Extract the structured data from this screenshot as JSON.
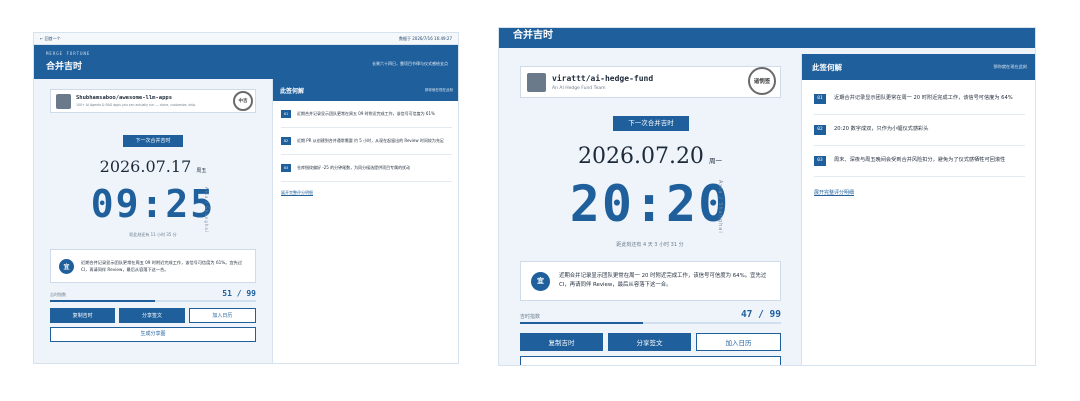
{
  "left_panel": {
    "nav": {
      "back": "← 回首一个",
      "published": "数据于 2026/7/16 16:49:27"
    },
    "header": {
      "kicker": "MERGE FORTUNE",
      "title": "合并吉时",
      "tagline": "长果六十四日，靠项目节律与仪式感给支点"
    },
    "repo": {
      "name": "Shubhamsaboo/awesome-llm-apps",
      "desc": "100+ AI Agents & RAG apps you can actually run — clone, customize, ship.",
      "seal": "中吉"
    },
    "next_button": "下一次合并吉时",
    "date": "2026.07.17",
    "weekday": "周五",
    "time": "09:25",
    "timezone": "Asia / Shanghai",
    "remaining": "距此刻还有 11 小时 35 分",
    "advice_badge": "宜",
    "advice": "近期合并记录显示团队更常在周五 09 时附近完成工作，该信号可信度为 61%。宜先过 CI，再请同伴 Review，最后从容落下这一合。",
    "index_label": "吉时指数",
    "index_value": "51 / 99",
    "index_fraction": 0.51,
    "buttons": {
      "copy": "复制吉时",
      "share": "分享签文",
      "calendar": "加入日历",
      "poster": "生成分享图"
    },
    "sign": {
      "title": "此签何解",
      "subtitle": "那你就在现在此刻",
      "items": [
        {
          "num": "01",
          "text": "近期合并记录显示团队更常在周五 09 时附近完成工作，该信号可信度为 61%"
        },
        {
          "num": "02",
          "text": "近期 PR 从创建到合并通常需要 约 5 小时，从现在起留出的 Review 时间较为充足"
        },
        {
          "num": "03",
          "text": "仓库指纹偏好 -25 的分钟尾数，为同分候选提供项目专属的扰动"
        }
      ],
      "more": "展开完整评分明细"
    }
  },
  "right_panel": {
    "header": {
      "title": "合并吉时"
    },
    "repo": {
      "name": "virattt/ai-hedge-fund",
      "desc": "An AI Hedge Fund Team",
      "seal": "诸悯签"
    },
    "next_button": "下一次合并吉时",
    "date": "2026.07.20",
    "weekday": "周一",
    "time": "20:20",
    "timezone": "Asia / Shanghai",
    "remaining": "距此刻还有 4 天 3 小时 31 分",
    "advice_badge": "宜",
    "advice": "近期合并记录显示团队更常在周一 20 时附近完成工作，该信号可信度为 64%。宜先过 CI，再请同伴 Review，最后从容落下这一合。",
    "index_label": "吉时指数",
    "index_value": "47 / 99",
    "index_fraction": 0.47,
    "buttons": {
      "copy": "复制吉时",
      "share": "分享签文",
      "calendar": "加入日历"
    },
    "sign": {
      "title": "此签何解",
      "subtitle": "那你就在现在此刻",
      "items": [
        {
          "num": "01",
          "text": "近期合并记录显示团队更常在周一 20 时附近完成工作，该信号可信度为 64%"
        },
        {
          "num": "02",
          "text": "20:20 数字成双，只作为小幅仪式感彩头"
        },
        {
          "num": "03",
          "text": "周末、深夜与周五晚间会受到合并风险扣分，避免为了仪式感牺牲可回滚性"
        }
      ],
      "more": "展开完整评分明细"
    }
  }
}
